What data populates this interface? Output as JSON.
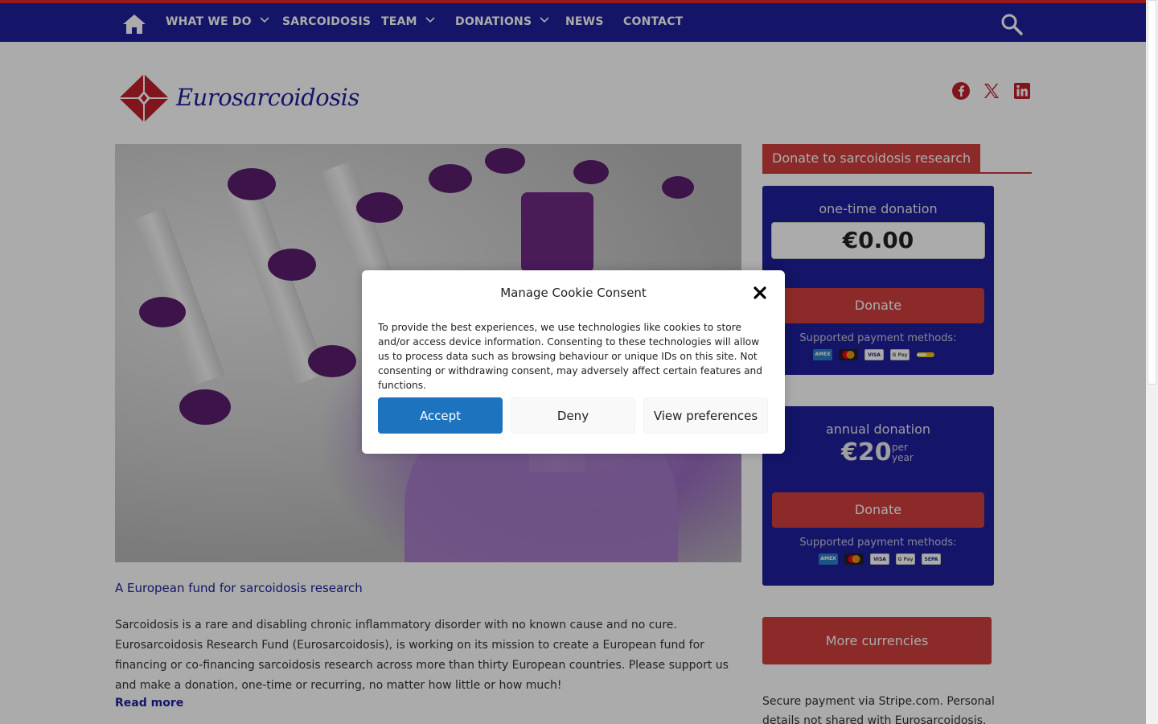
{
  "nav": {
    "items": [
      {
        "label": "WHAT WE DO",
        "has_dropdown": true
      },
      {
        "label": "SARCOIDOSIS",
        "has_dropdown": false
      },
      {
        "label": "TEAM",
        "has_dropdown": true
      },
      {
        "label": "DONATIONS",
        "has_dropdown": true
      },
      {
        "label": "NEWS",
        "has_dropdown": false
      },
      {
        "label": "CONTACT",
        "has_dropdown": false
      }
    ],
    "icons": {
      "home": "home-icon",
      "search": "search-icon"
    }
  },
  "header": {
    "logo_text": "Eurosarcoidosis",
    "social": [
      "facebook-icon",
      "x-icon",
      "linkedin-icon"
    ]
  },
  "article": {
    "title": "A European fund for sarcoidosis research",
    "body": "Sarcoidosis is a rare and disabling chronic inflammatory disorder with no known cause and no cure. Eurosarcoidosis Research Fund (Eurosarcoidosis), is working on its mission to create a European fund for financing or co-financing sarcoidosis research across more than thirty European countries. Please support us and make a donation, one-time or recurring, no matter how little or how much!",
    "read_more": "Read more"
  },
  "sidebar": {
    "title": "Donate to sarcoidosis research",
    "one_time": {
      "label": "one-time donation",
      "amount": "€0.00",
      "button": "Donate",
      "payment_label": "Supported payment methods:",
      "payment_methods": [
        "AMEX",
        "Mastercard",
        "VISA",
        "G Pay",
        "Link"
      ]
    },
    "annual": {
      "label": "annual donation",
      "amount": "€20",
      "per": "per",
      "period": "year",
      "button": "Donate",
      "payment_label": "Supported payment methods:",
      "payment_methods": [
        "AMEX",
        "Mastercard",
        "VISA",
        "G Pay",
        "SEPA"
      ]
    },
    "more_currencies": "More currencies",
    "secure_text": "Secure payment via Stripe.com. Personal details not shared with Eurosarcoidosis."
  },
  "cookie_modal": {
    "title": "Manage Cookie Consent",
    "text": "To provide the best experiences, we use technologies like cookies to store and/or access device information. Consenting to these technologies will allow us to process data such as browsing behaviour or unique IDs on this site. Not consenting or withdrawing consent, may adversely affect certain features and functions.",
    "accept": "Accept",
    "deny": "Deny",
    "preferences": "View preferences"
  },
  "colors": {
    "nav_blue": "#1e1e9b",
    "accent_red": "#d13f3f",
    "accept_blue": "#1e73be"
  }
}
